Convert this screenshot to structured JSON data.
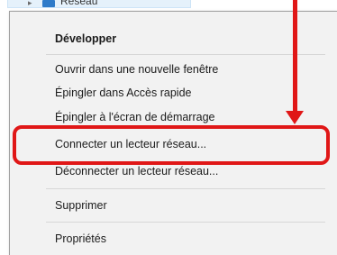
{
  "tree": {
    "selected_item_label": "Réseau"
  },
  "context_menu": {
    "items": [
      {
        "label": "Développer",
        "bold": true
      },
      {
        "label": "Ouvrir dans une nouvelle fenêtre"
      },
      {
        "label": "Épingler dans Accès rapide"
      },
      {
        "label": "Épingler à l'écran de démarrage"
      },
      {
        "label": "Connecter un lecteur réseau..."
      },
      {
        "label": "Déconnecter un lecteur réseau..."
      },
      {
        "label": "Supprimer"
      },
      {
        "label": "Propriétés"
      }
    ]
  },
  "annotation": {
    "color": "#e01717",
    "highlighted_item": "Connecter un lecteur réseau..."
  }
}
